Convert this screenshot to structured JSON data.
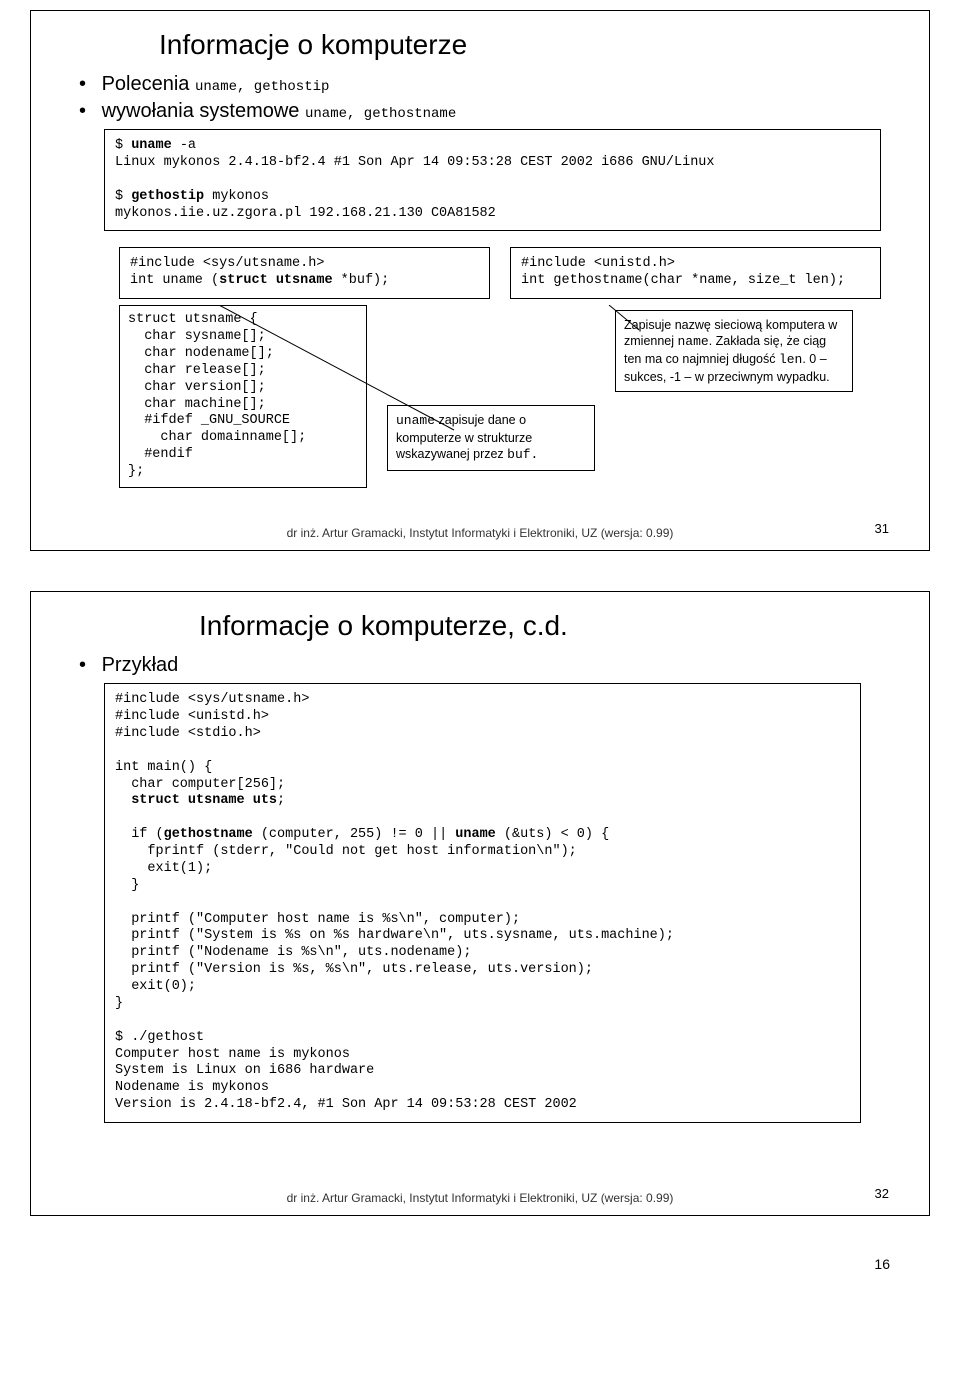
{
  "slide1": {
    "title": "Informacje o komputerze",
    "bullet1_pre": "Polecenia ",
    "bullet1_code": "uname, gethostip",
    "bullet2_pre": "wywołania systemowe ",
    "bullet2_code": "uname, gethostname",
    "shell": "$ uname -a\nLinux mykonos 2.4.18-bf2.4 #1 Son Apr 14 09:53:28 CEST 2002 i686 GNU/Linux\n\n$ gethostip mykonos\nmykonos.iie.uz.zgora.pl 192.168.21.130 C0A81582",
    "inc1": "#include <sys/utsname.h>\nint uname (struct utsname *buf);",
    "inc2": "#include <unistd.h>\nint gethostname(char *name, size_t len);",
    "struct": "struct utsname {\n  char sysname[];\n  char nodename[];\n  char release[];\n  char version[];\n  char machine[];\n  #ifdef _GNU_SOURCE\n    char domainname[];\n  #endif\n};",
    "note_uname_pre": "uname",
    "note_uname_rest": " zapisuje dane o komputerze w strukturze wskazywanej przez ",
    "note_uname_code": "buf.",
    "note_gethost_l1": "Zapisuje nazwę sieciową komputera w zmiennej ",
    "note_gethost_code1": "name",
    "note_gethost_l2": ". Zakłada się, że ciąg ten ma co najmniej długość ",
    "note_gethost_code2": "len",
    "note_gethost_l3": ". 0 – sukces, -1 – w przeciwnym wypadku.",
    "footer": "dr inż. Artur Gramacki, Instytut Informatyki i Elektroniki, UZ (wersja: 0.99)",
    "pagenum": "31"
  },
  "slide2": {
    "title": "Informacje o komputerze, c.d.",
    "bullet1": "Przykład",
    "code": "#include <sys/utsname.h>\n#include <unistd.h>\n#include <stdio.h>\n\nint main() {\n  char computer[256];\n  struct utsname uts;\n\n  if (gethostname (computer, 255) != 0 || uname (&uts) < 0) {\n    fprintf (stderr, \"Could not get host information\\n\");\n    exit(1);\n  }\n\n  printf (\"Computer host name is %s\\n\", computer);\n  printf (\"System is %s on %s hardware\\n\", uts.sysname, uts.machine);\n  printf (\"Nodename is %s\\n\", uts.nodename);\n  printf (\"Version is %s, %s\\n\", uts.release, uts.version);\n  exit(0);\n}\n\n$ ./gethost\nComputer host name is mykonos\nSystem is Linux on i686 hardware\nNodename is mykonos\nVersion is 2.4.18-bf2.4, #1 Son Apr 14 09:53:28 CEST 2002",
    "footer": "dr inż. Artur Gramacki, Instytut Informatyki i Elektroniki, UZ (wersja: 0.99)",
    "pagenum": "32"
  },
  "docpage": "16"
}
